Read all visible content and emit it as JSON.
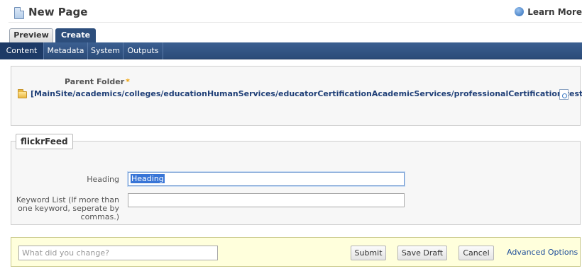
{
  "header": {
    "title": "New Page",
    "learn_more": "Learn More"
  },
  "mode_tabs": [
    {
      "label": "Preview",
      "active": false
    },
    {
      "label": "Create",
      "active": true
    }
  ],
  "subnav": [
    {
      "label": "Content",
      "active": true
    },
    {
      "label": "Metadata",
      "active": false
    },
    {
      "label": "System",
      "active": false
    },
    {
      "label": "Outputs",
      "active": false
    }
  ],
  "parent_folder": {
    "label": "Parent Folder",
    "required_marker": "*",
    "path": "[MainSite/academics/colleges/educationHumanServices/educatorCertificationAcademicServices/professionalCertification/test]"
  },
  "flickr_feed": {
    "legend": "flickrFeed",
    "heading_label": "Heading",
    "heading_value": "Heading",
    "keyword_label_line1": "Keyword List (If more than",
    "keyword_label_line2": "one keyword, seperate by",
    "keyword_label_line3": "commas.)",
    "keyword_value": ""
  },
  "action_bar": {
    "change_placeholder": "What did you change?",
    "submit": "Submit",
    "save_draft": "Save Draft",
    "cancel": "Cancel",
    "advanced": "Advanced Options"
  },
  "colors": {
    "nav_blue": "#2d4e7c",
    "path_text": "#1f3f77",
    "action_bar_bg": "#ffffdc",
    "selection": "#3875d7"
  }
}
